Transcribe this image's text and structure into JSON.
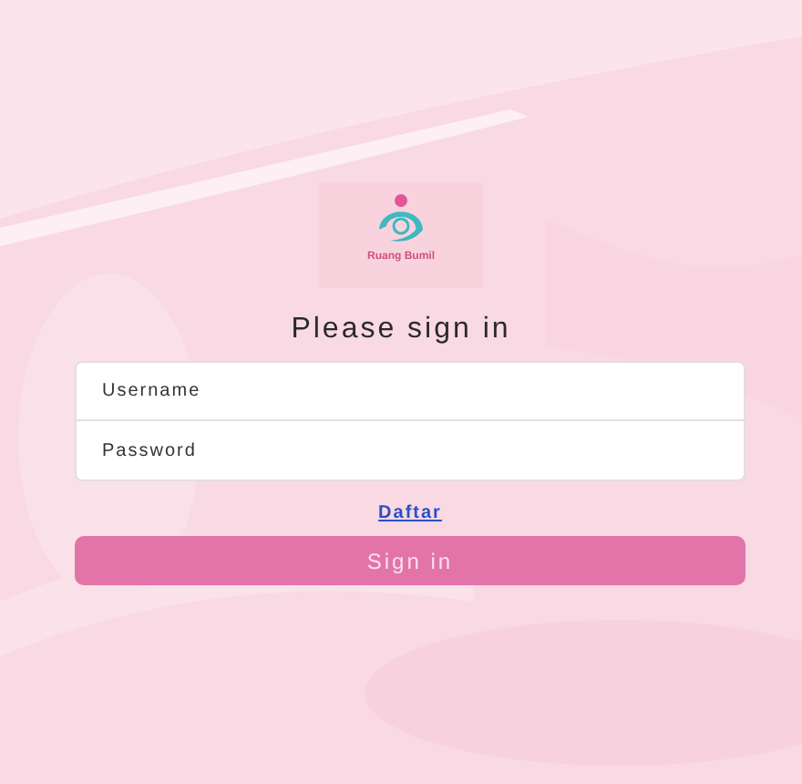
{
  "logo": {
    "caption": "Ruang Bumil"
  },
  "title": "Please sign in",
  "fields": [
    {
      "placeholder": "Username"
    },
    {
      "placeholder": "Password"
    }
  ],
  "register_link": "Daftar",
  "submit": "Sign in"
}
